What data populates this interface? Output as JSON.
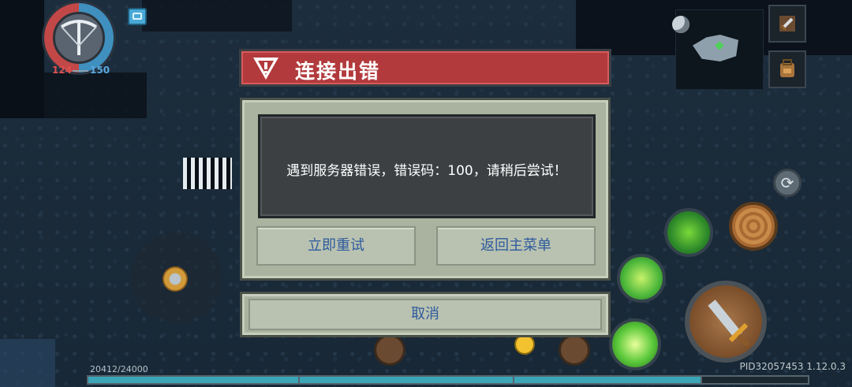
{
  "hud": {
    "hp_current": "124",
    "hp_max": "150",
    "xp_text": "20412/24000",
    "xp_fraction": 0.851,
    "version": "PID32057453 1.12.0.3"
  },
  "dialog": {
    "title": "连接出错",
    "message": "遇到服务器错误，错误码：100，请稍后尝试！",
    "retry_label": "立即重试",
    "main_menu_label": "返回主菜单",
    "cancel_label": "取消"
  },
  "colors": {
    "title_bar": "#b23a3c",
    "dialog_bg": "#a9b39f",
    "button_text": "#2e5a9e",
    "hp_red": "#e05050",
    "mp_blue": "#5aa9e0",
    "xp_fill": "#3aa6b8"
  },
  "icons": [
    "crossbow-icon",
    "chat-icon",
    "moon-icon",
    "sword-icon",
    "backpack-icon",
    "refresh-icon",
    "warning-icon",
    "attack-sword-icon",
    "emoji-icon"
  ]
}
